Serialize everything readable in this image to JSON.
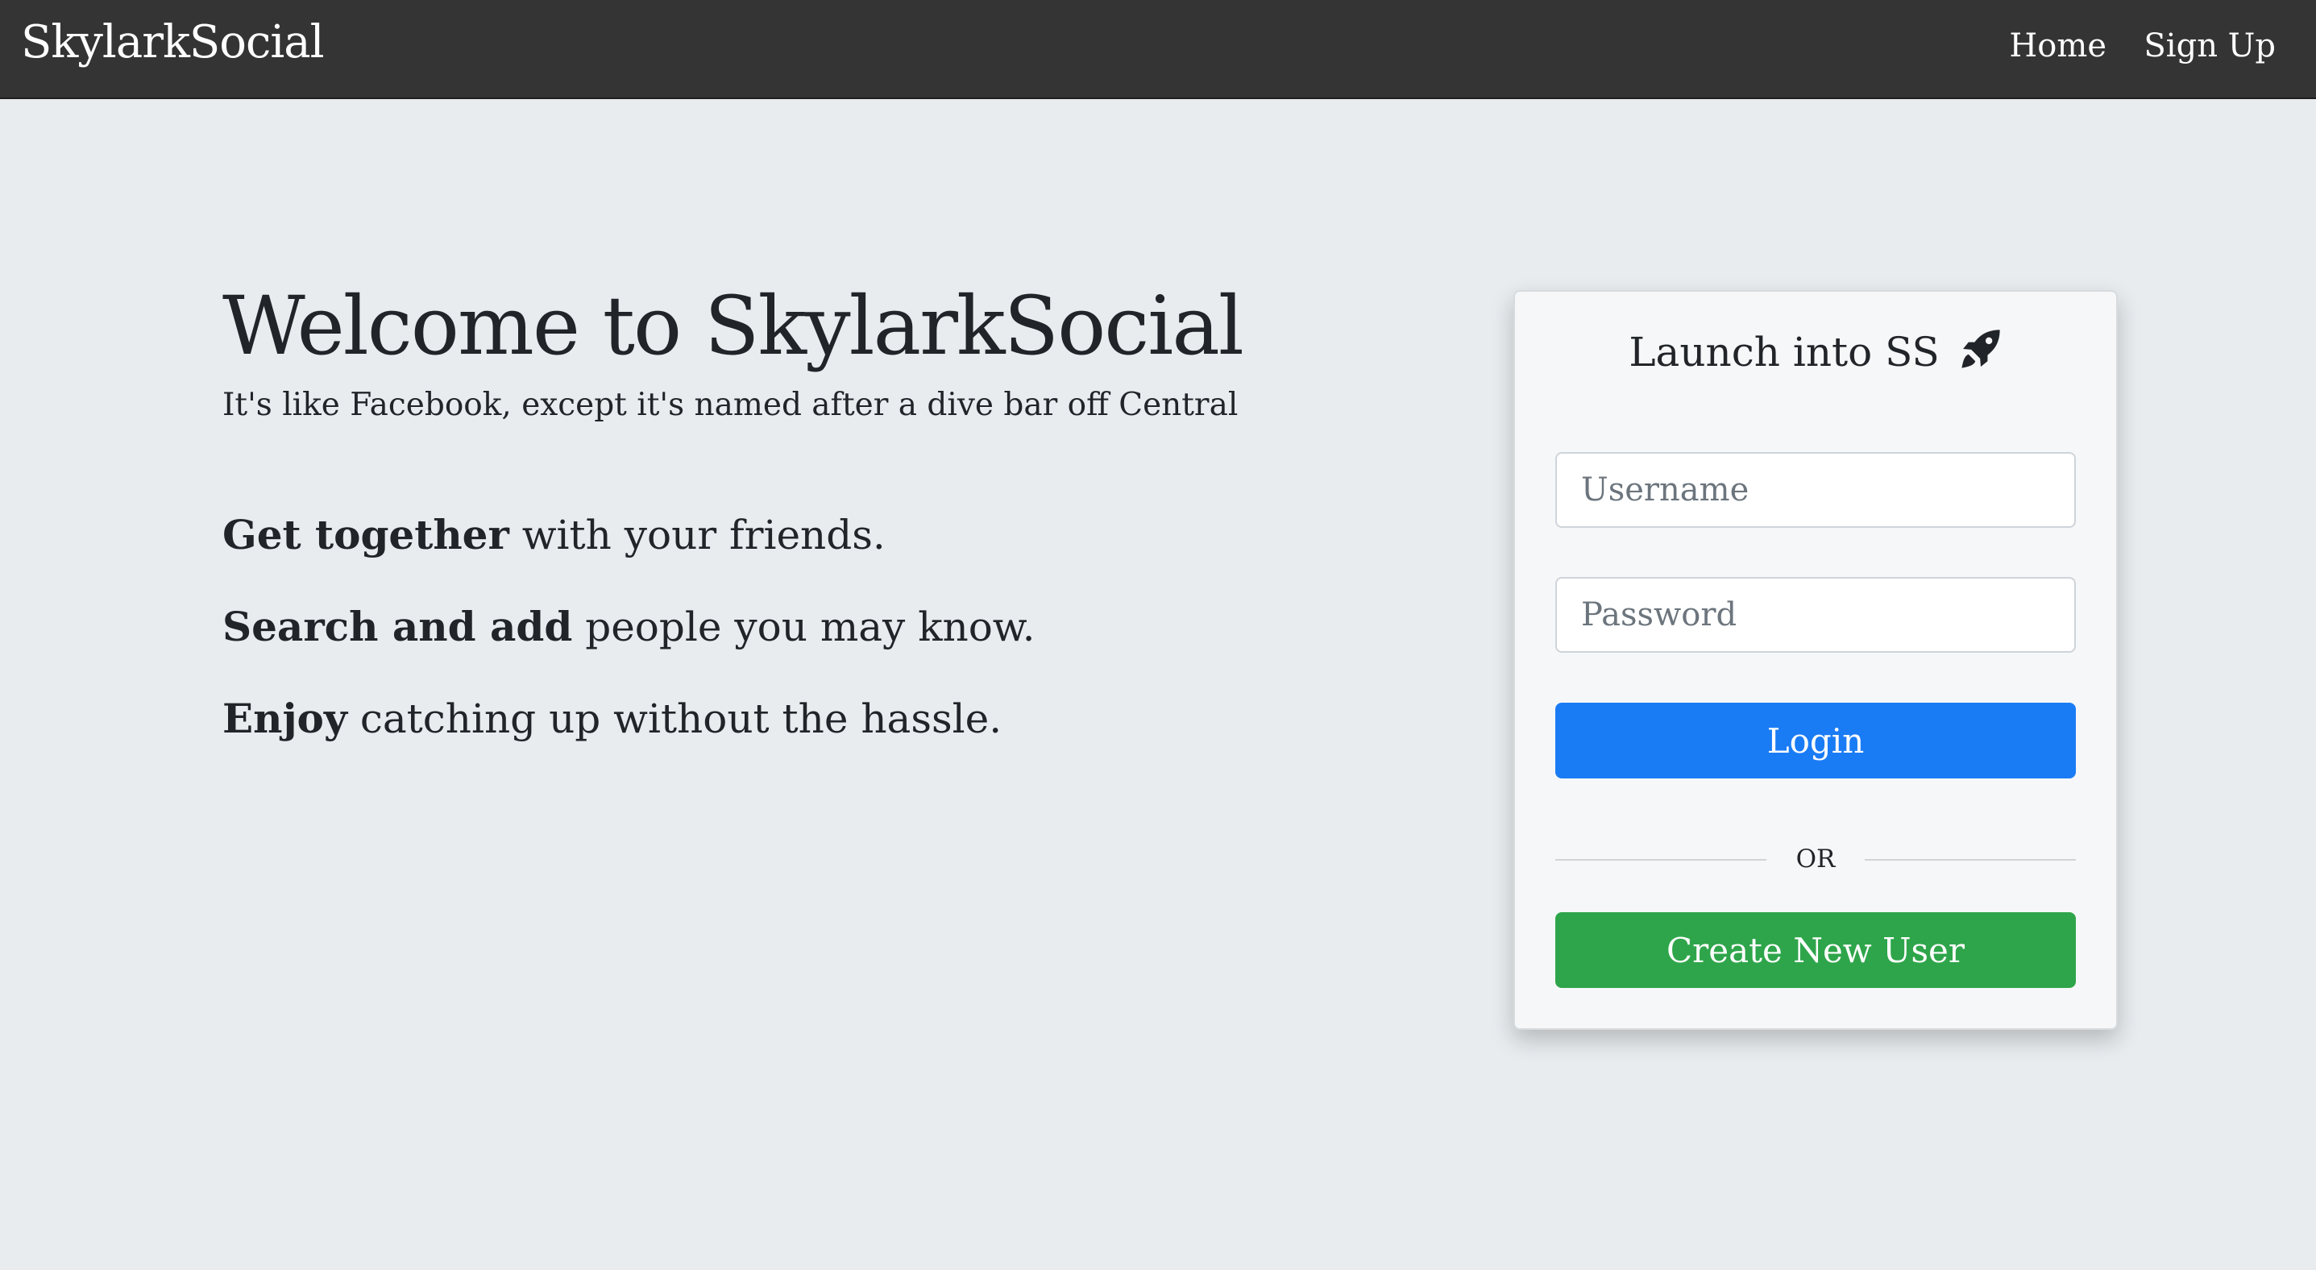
{
  "navbar": {
    "brand": "SkylarkSocial",
    "links": [
      "Home",
      "Sign Up"
    ]
  },
  "hero": {
    "title": "Welcome to SkylarkSocial",
    "subtitle": "It's like Facebook, except it's named after a dive bar off Central",
    "features": [
      {
        "bold": "Get together",
        "rest": " with your friends."
      },
      {
        "bold": "Search and add",
        "rest": " people you may know."
      },
      {
        "bold": "Enjoy",
        "rest": " catching up without the hassle."
      }
    ]
  },
  "login_card": {
    "title": "Launch into SS",
    "title_icon": "rocket-icon",
    "username_placeholder": "Username",
    "password_placeholder": "Password",
    "login_label": "Login",
    "divider_text": "OR",
    "create_label": "Create New User"
  },
  "colors": {
    "navbar_bg": "#343434",
    "page_bg": "#e8ecef",
    "login_button": "#1a7cf5",
    "create_button": "#2ea54a"
  }
}
